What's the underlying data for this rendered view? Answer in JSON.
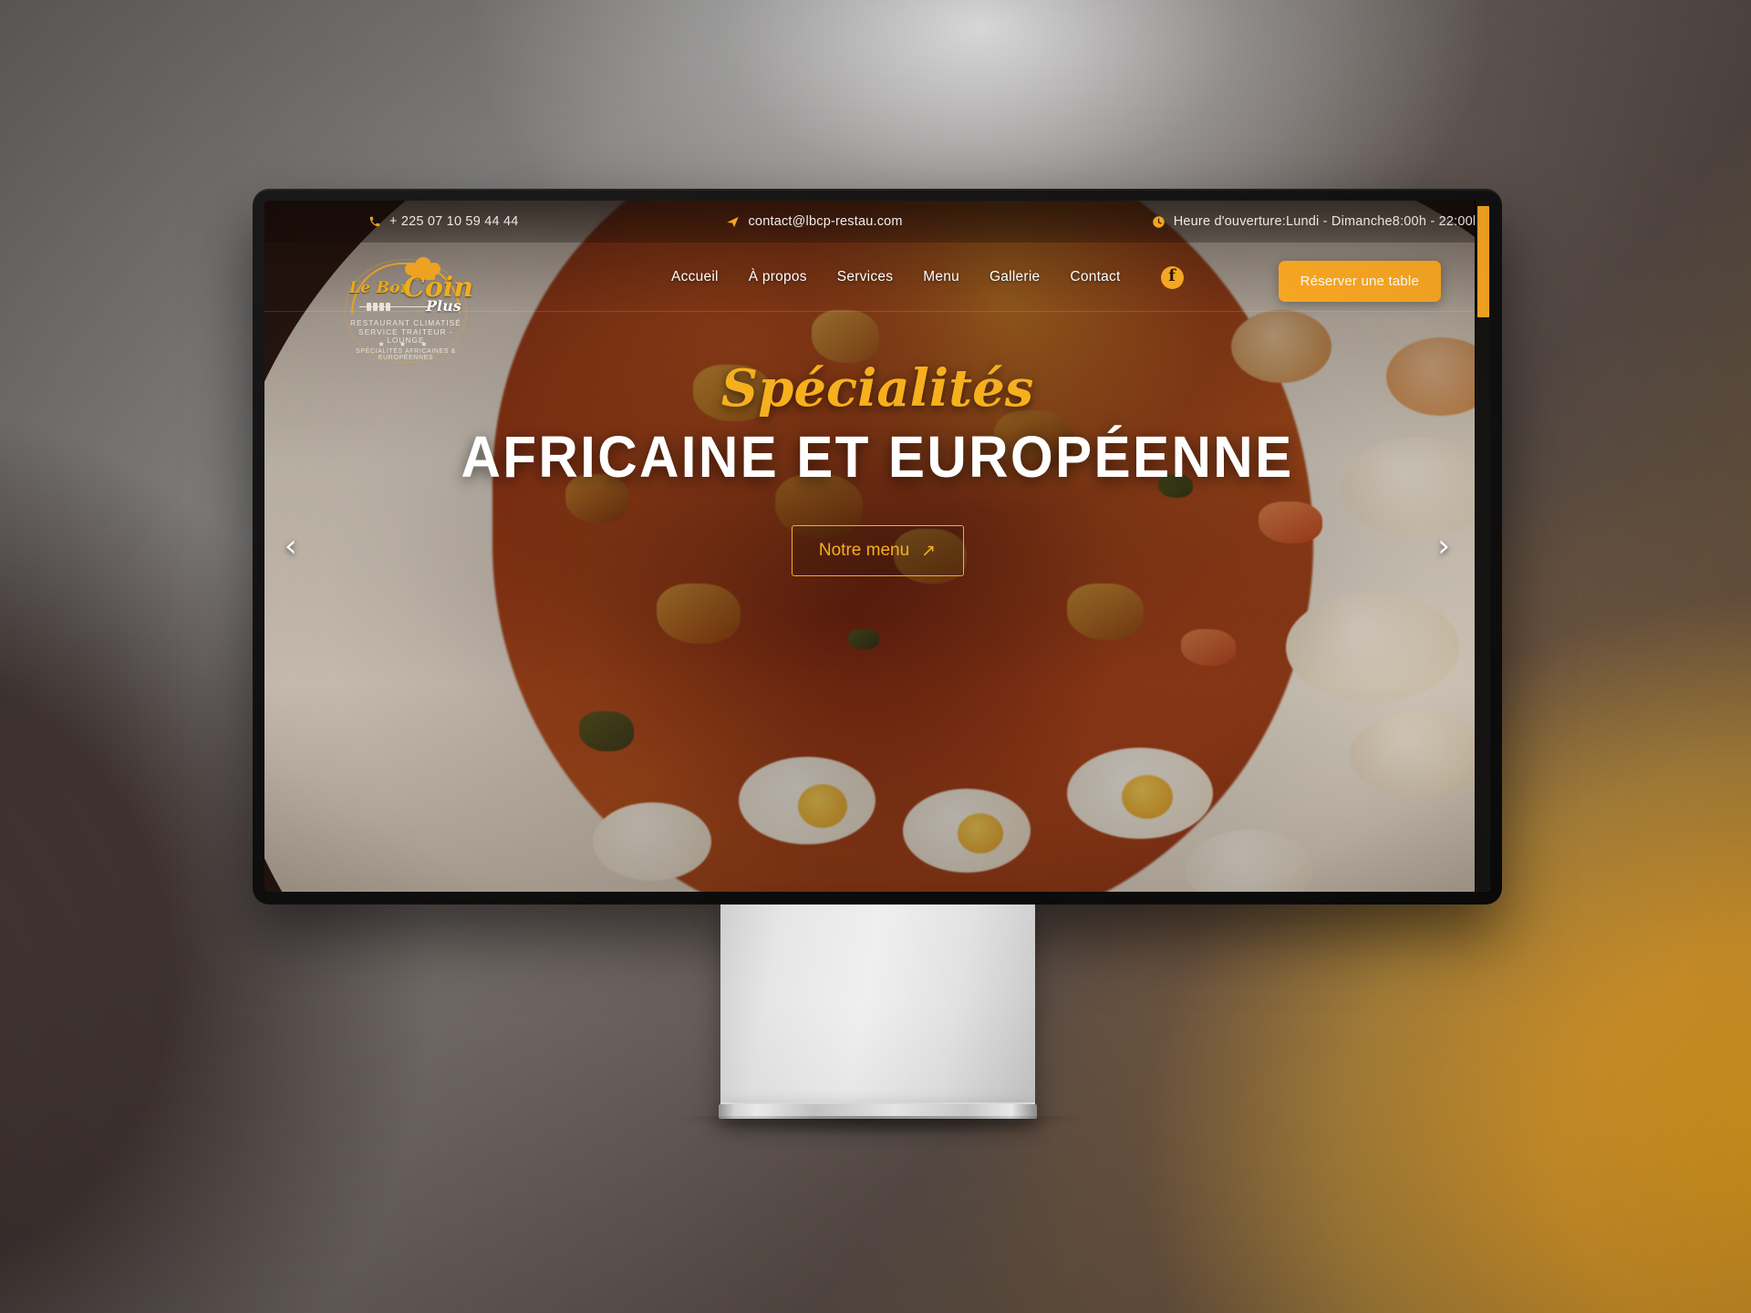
{
  "topbar": {
    "phone": "+ 225 07 10 59 44 44",
    "phone_icon": "phone-icon",
    "email": "contact@lbcp-restau.com",
    "email_icon": "paper-plane-icon",
    "hours": "Heure d'ouverture:Lundi - Dimanche8:00h - 22:00h",
    "hours_icon": "clock-icon"
  },
  "logo": {
    "line_top": "Le Bon",
    "line_main": "Coin",
    "line_sub": "Plus",
    "tagline_1": "RESTAURANT CLIMATISÉ",
    "tagline_2": "SERVICE TRAITEUR - LOUNGE",
    "stars": "★ ★ ★",
    "curved_text": "SPÉCIALITÉS AFRICAINES & EUROPÉENNES"
  },
  "nav": {
    "items": [
      {
        "label": "Accueil"
      },
      {
        "label": "À propos"
      },
      {
        "label": "Services"
      },
      {
        "label": "Menu"
      },
      {
        "label": "Gallerie"
      },
      {
        "label": "Contact"
      }
    ],
    "facebook_icon": "facebook-icon",
    "facebook_glyph": "f",
    "reserve_label": "Réserver une table"
  },
  "hero": {
    "script_title": "Spécialités",
    "main_title": "AFRICAINE ET EUROPÉENNE",
    "cta_label": "Notre menu",
    "cta_arrow": "↗",
    "prev_arrow": "‹",
    "next_arrow": "›"
  },
  "colors": {
    "accent": "#f5a623",
    "button": "#f9a722",
    "script_gold": "#f6b01e",
    "text_light": "#ffffff",
    "bezel": "#0a0a0a",
    "scrollbar_thumb": "#f9a722"
  }
}
